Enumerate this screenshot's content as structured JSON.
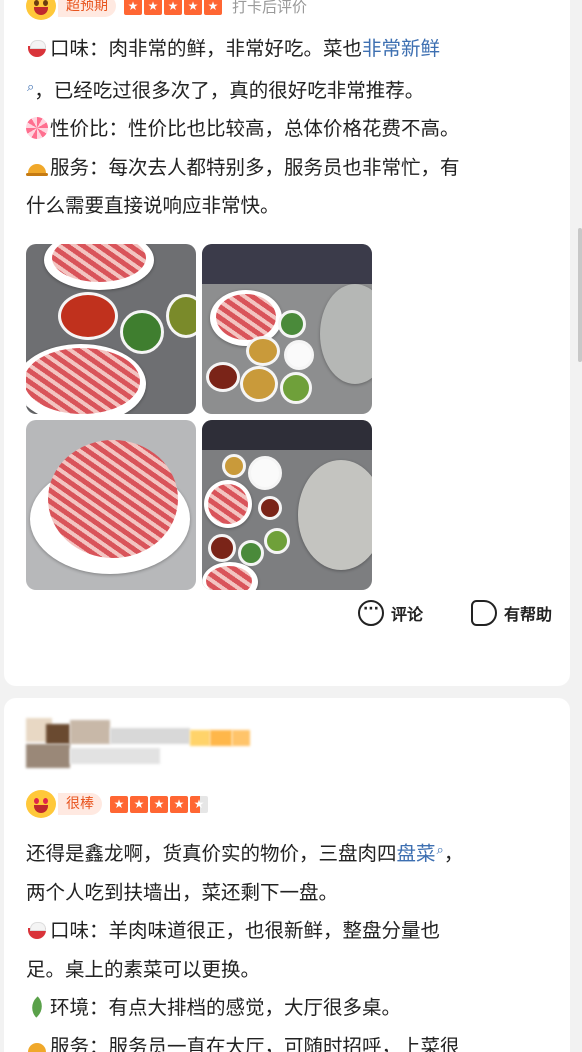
{
  "review1": {
    "rating_tag": "超预期",
    "after_tag": "打卡后评价",
    "lines": [
      {
        "icon": "bowl-icon",
        "segments": [
          {
            "t": "口味：肉非常的鲜，非常好吃。菜也"
          },
          {
            "t": "非常新鲜",
            "kw": true
          }
        ]
      },
      {
        "segments": [
          {
            "t": "",
            "search": true
          },
          {
            "t": "，已经吃过很多次了，真的很好吃非常推荐。"
          }
        ]
      },
      {
        "icon": "candy-icon",
        "segments": [
          {
            "t": "性价比：性价比也比较高，总体价格花费不高。"
          }
        ]
      },
      {
        "icon": "bell-icon",
        "segments": [
          {
            "t": "服务：每次去人都特别多，服务员也非常忙，有"
          }
        ]
      },
      {
        "segments": [
          {
            "t": "什么需要直接说响应非常快。"
          }
        ]
      }
    ],
    "actions": {
      "comment": "评论",
      "helpful": "有帮助"
    }
  },
  "review2": {
    "rating_tag": "很棒",
    "stars": 4.5,
    "lines": [
      {
        "segments": [
          {
            "t": "还得是鑫龙啊，货真价实的物价，三盘肉四"
          },
          {
            "t": "盘菜",
            "kw": true
          },
          {
            "t": "",
            "search": true
          },
          {
            "t": "，"
          }
        ]
      },
      {
        "segments": [
          {
            "t": "两个人吃到扶墙出，菜还剩下一盘。"
          }
        ]
      },
      {
        "icon": "bowl-icon",
        "segments": [
          {
            "t": "口味：羊肉味道很正，也很新鲜，整盘分量也"
          }
        ]
      },
      {
        "segments": [
          {
            "t": "足。桌上的素菜可以更换。"
          }
        ]
      },
      {
        "icon": "leaf-icon",
        "segments": [
          {
            "t": "环境：有点大排档的感觉，大厅很多桌。"
          }
        ]
      },
      {
        "icon": "bell-icon",
        "segments": [
          {
            "t": "服务：服务员一直在大厅，可随时招呼，上菜很"
          }
        ]
      }
    ]
  },
  "search_glyph": "⌕",
  "star_glyph": "★",
  "colors": {
    "accent": "#ff6633",
    "link": "#3d6fb1",
    "tag_bg": "#ffe9e1"
  }
}
